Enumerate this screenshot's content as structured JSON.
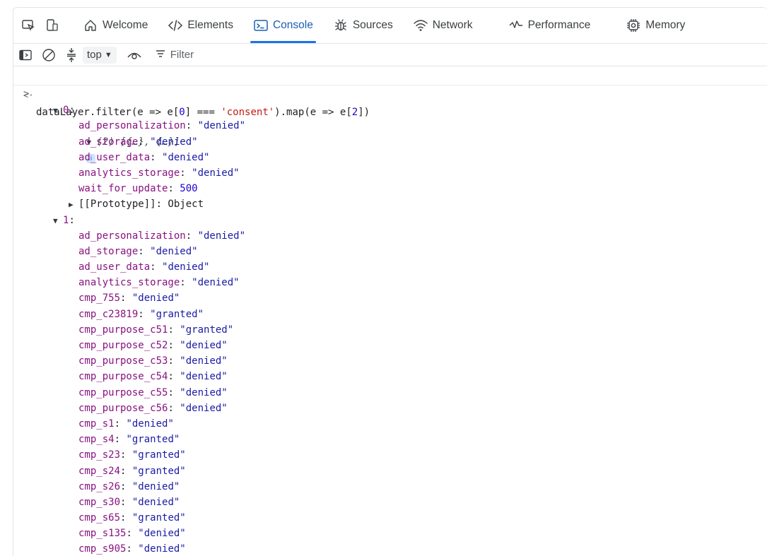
{
  "tabs": [
    {
      "label": "Welcome",
      "icon": "home-icon",
      "active": false
    },
    {
      "label": "Elements",
      "icon": "code-tag-icon",
      "active": false
    },
    {
      "label": "Console",
      "icon": "console-icon",
      "active": true
    },
    {
      "label": "Sources",
      "icon": "bug-icon",
      "active": false
    },
    {
      "label": "Network",
      "icon": "wifi-icon",
      "active": false
    },
    {
      "label": "Performance",
      "icon": "performance-gauge-icon",
      "active": false
    },
    {
      "label": "Memory",
      "icon": "chip-icon",
      "active": false
    }
  ],
  "toolbar": {
    "context": "top",
    "filter_placeholder": "Filter"
  },
  "console": {
    "command": "dataLayer.filter(e => e[0] === 'consent').map(e => e[2])",
    "result_summary": "(2) [{…}, {…}]",
    "entries": [
      {
        "index": "0",
        "props": [
          {
            "key": "ad_personalization",
            "value": "\"denied\""
          },
          {
            "key": "ad_storage",
            "value": "\"denied\""
          },
          {
            "key": "ad_user_data",
            "value": "\"denied\""
          },
          {
            "key": "analytics_storage",
            "value": "\"denied\""
          },
          {
            "key": "wait_for_update",
            "value": "500"
          }
        ],
        "prototype": "[[Prototype]]: Object"
      },
      {
        "index": "1",
        "props": [
          {
            "key": "ad_personalization",
            "value": "\"denied\""
          },
          {
            "key": "ad_storage",
            "value": "\"denied\""
          },
          {
            "key": "ad_user_data",
            "value": "\"denied\""
          },
          {
            "key": "analytics_storage",
            "value": "\"denied\""
          },
          {
            "key": "cmp_755",
            "value": "\"denied\""
          },
          {
            "key": "cmp_c23819",
            "value": "\"granted\""
          },
          {
            "key": "cmp_purpose_c51",
            "value": "\"granted\""
          },
          {
            "key": "cmp_purpose_c52",
            "value": "\"denied\""
          },
          {
            "key": "cmp_purpose_c53",
            "value": "\"denied\""
          },
          {
            "key": "cmp_purpose_c54",
            "value": "\"denied\""
          },
          {
            "key": "cmp_purpose_c55",
            "value": "\"denied\""
          },
          {
            "key": "cmp_purpose_c56",
            "value": "\"denied\""
          },
          {
            "key": "cmp_s1",
            "value": "\"denied\""
          },
          {
            "key": "cmp_s4",
            "value": "\"granted\""
          },
          {
            "key": "cmp_s23",
            "value": "\"granted\""
          },
          {
            "key": "cmp_s24",
            "value": "\"granted\""
          },
          {
            "key": "cmp_s26",
            "value": "\"denied\""
          },
          {
            "key": "cmp_s30",
            "value": "\"denied\""
          },
          {
            "key": "cmp_s65",
            "value": "\"granted\""
          },
          {
            "key": "cmp_s135",
            "value": "\"denied\""
          },
          {
            "key": "cmp_s905",
            "value": "\"denied\""
          }
        ]
      }
    ]
  },
  "colors": {
    "accent": "#1a73e8",
    "key": "#881280",
    "string": "#c41a16",
    "number": "#1c00cf"
  }
}
